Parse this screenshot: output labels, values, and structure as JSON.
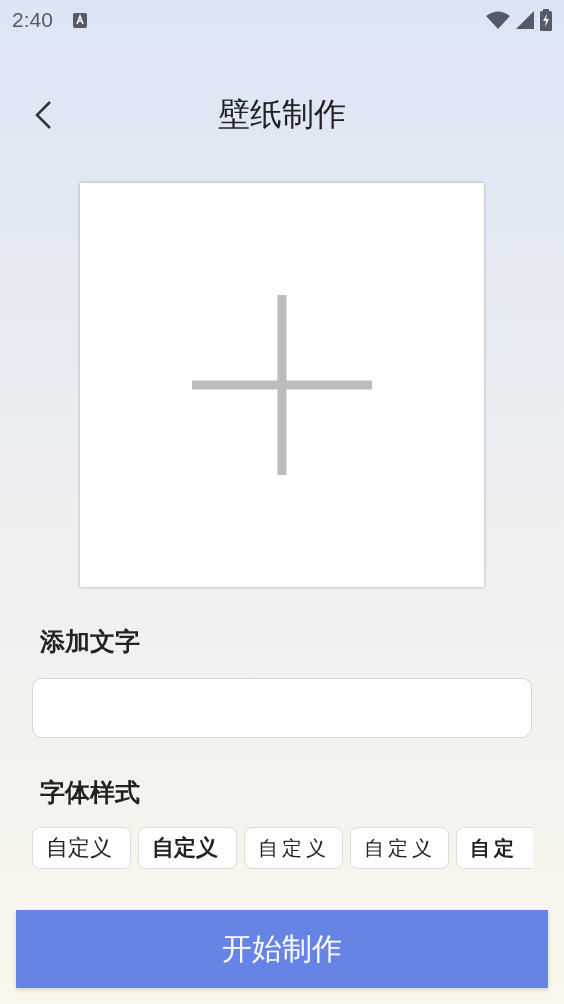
{
  "status_bar": {
    "time": "2:40"
  },
  "header": {
    "title": "壁纸制作"
  },
  "image_picker": {
    "kind": "add"
  },
  "text_section": {
    "label": "添加文字"
  },
  "font_section": {
    "label": "字体样式",
    "fonts": [
      {
        "label": "自定义",
        "selected": false
      },
      {
        "label": "自定义",
        "selected": false
      },
      {
        "label": "自定义",
        "selected": false
      },
      {
        "label": "自定义",
        "selected": false
      },
      {
        "label": "自定",
        "selected": false
      }
    ]
  },
  "start_button": {
    "label": "开始制作"
  }
}
